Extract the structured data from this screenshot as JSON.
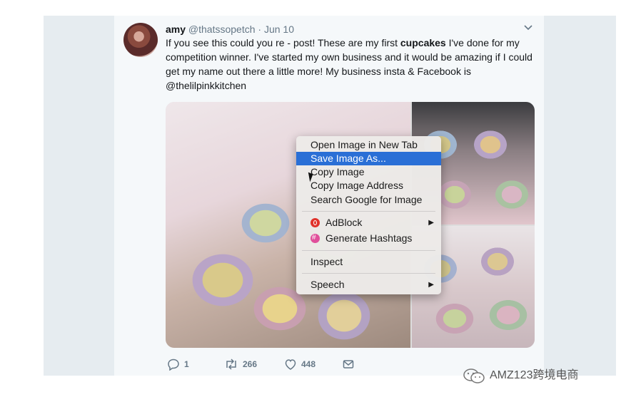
{
  "tweet": {
    "author_name": "amy",
    "author_handle": "@thatssopetch",
    "date": "· Jun 10",
    "text_part1": "If you see this could you re - post! These are my first ",
    "text_bold": "cupcakes",
    "text_part2": " I've done for my competition winner. I've started my own business and it would be amazing if I could get my name out there a little more! My business insta & Facebook is @thelilpinkkitchen",
    "reply_count": "1",
    "retweet_count": "266",
    "like_count": "448"
  },
  "context_menu": {
    "items": [
      {
        "label": "Open Image in New Tab"
      },
      {
        "label": "Save Image As..."
      },
      {
        "label": "Copy Image"
      },
      {
        "label": "Copy Image Address"
      },
      {
        "label": "Search Google for Image"
      },
      {
        "label": "AdBlock"
      },
      {
        "label": "Generate Hashtags"
      },
      {
        "label": "Inspect"
      },
      {
        "label": "Speech"
      }
    ],
    "selected_color": "#2a6fd6"
  },
  "watermark": {
    "text": "AMZ123跨境电商"
  },
  "icons": [
    "chevron-down-icon",
    "reply-icon",
    "retweet-icon",
    "like-icon",
    "message-icon",
    "adblock-icon",
    "hashtag-icon",
    "submenu-arrow-icon",
    "wechat-icon"
  ]
}
